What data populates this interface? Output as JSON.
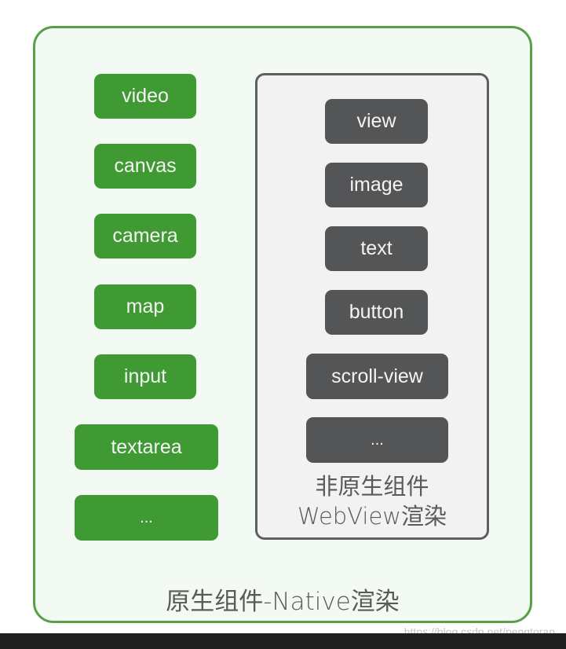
{
  "native_container": {
    "caption": "原生组件-Native渲染",
    "color": "#3f9a33",
    "items": [
      "video",
      "canvas",
      "camera",
      "map",
      "input",
      "textarea",
      "..."
    ]
  },
  "webview_container": {
    "caption_line1": "非原生组件",
    "caption_line2": "WebView渲染",
    "color": "#545556",
    "items": [
      "view",
      "image",
      "text",
      "button",
      "scroll-view",
      "..."
    ]
  },
  "watermark": "https://blog.csdn.net/pengtoran"
}
